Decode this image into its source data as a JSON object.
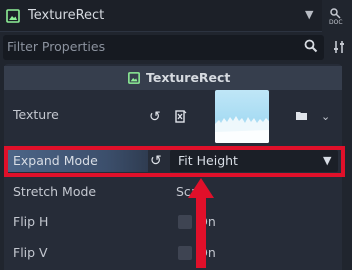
{
  "node_selector": {
    "label": "TextureRect",
    "icon": "texture-rect-icon"
  },
  "filter": {
    "placeholder": "Filter Properties"
  },
  "inspector": {
    "header": "TextureRect",
    "texture": {
      "label": "Texture"
    },
    "expand_mode": {
      "label": "Expand Mode",
      "value": "Fit Height"
    },
    "stretch_mode": {
      "label": "Stretch Mode",
      "value": "Scale"
    },
    "flip_h": {
      "label": "Flip H",
      "value_text": "On",
      "checked": false
    },
    "flip_v": {
      "label": "Flip V",
      "value_text": "On",
      "checked": false
    }
  },
  "colors": {
    "highlight": "#e0102a",
    "accent_node": "#8eef97"
  }
}
